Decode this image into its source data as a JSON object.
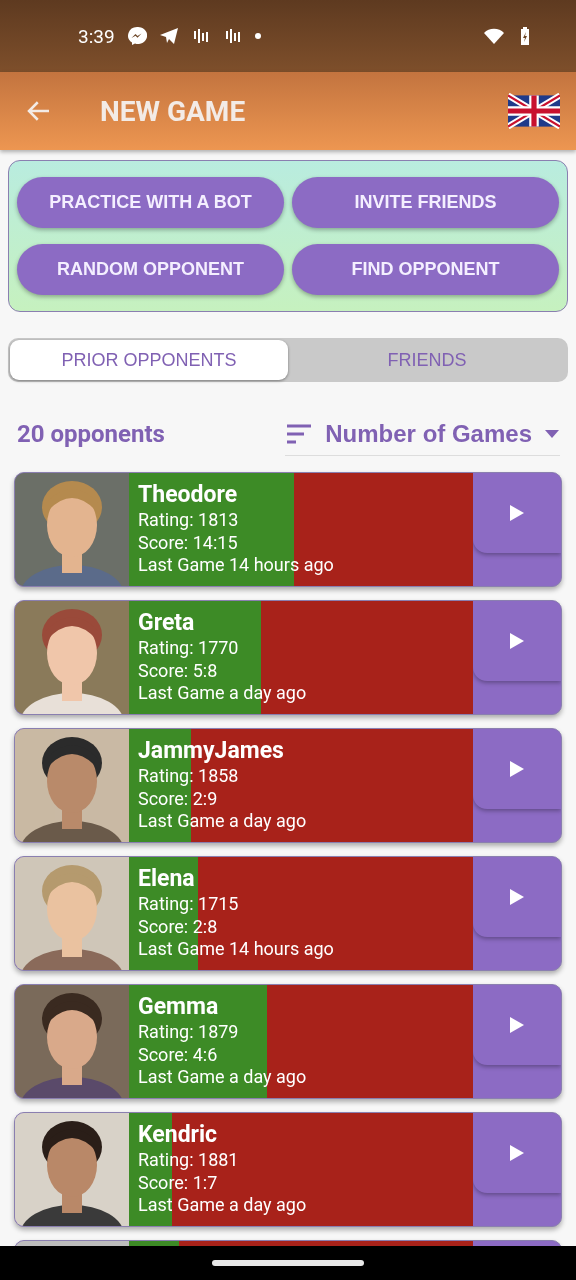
{
  "status_bar": {
    "time": "3:39"
  },
  "app_bar": {
    "title": "NEW GAME"
  },
  "actions": [
    "PRACTICE WITH A BOT",
    "INVITE FRIENDS",
    "RANDOM OPPONENT",
    "FIND OPPONENT"
  ],
  "tabs": [
    {
      "label": "PRIOR OPPONENTS",
      "selected": true
    },
    {
      "label": "FRIENDS",
      "selected": false
    }
  ],
  "count": "20 opponents",
  "sort": {
    "value": "Number of Games"
  },
  "opponents": [
    {
      "name": "Theodore",
      "rating": "Rating: 1813",
      "score": "Score: 14:15",
      "last_game": "Last Game 14 hours ago",
      "level": 0.48,
      "kind": "picture"
    },
    {
      "name": "Greta",
      "rating": "Rating: 1770",
      "score": "Score: 5:8",
      "last_game": "Last Game a day ago",
      "level": 0.385,
      "kind": "picture"
    },
    {
      "name": "JammyJames",
      "rating": "Rating: 1858",
      "score": "Score: 2:9",
      "last_game": "Last Game a day ago",
      "level": 0.18,
      "kind": "picture"
    },
    {
      "name": "Elena",
      "rating": "Rating: 1715",
      "score": "Score: 2:8",
      "last_game": "Last Game 14 hours ago",
      "level": 0.2,
      "kind": "picture"
    },
    {
      "name": "Gemma",
      "rating": "Rating: 1879",
      "score": "Score: 4:6",
      "last_game": "Last Game a day ago",
      "level": 0.4,
      "kind": "picture"
    },
    {
      "name": "Kendric",
      "rating": "Rating: 1881",
      "score": "Score: 1:7",
      "last_game": "Last Game a day ago",
      "level": 0.125,
      "kind": "picture"
    },
    {
      "level": 0.145,
      "kind": "picture"
    }
  ]
}
